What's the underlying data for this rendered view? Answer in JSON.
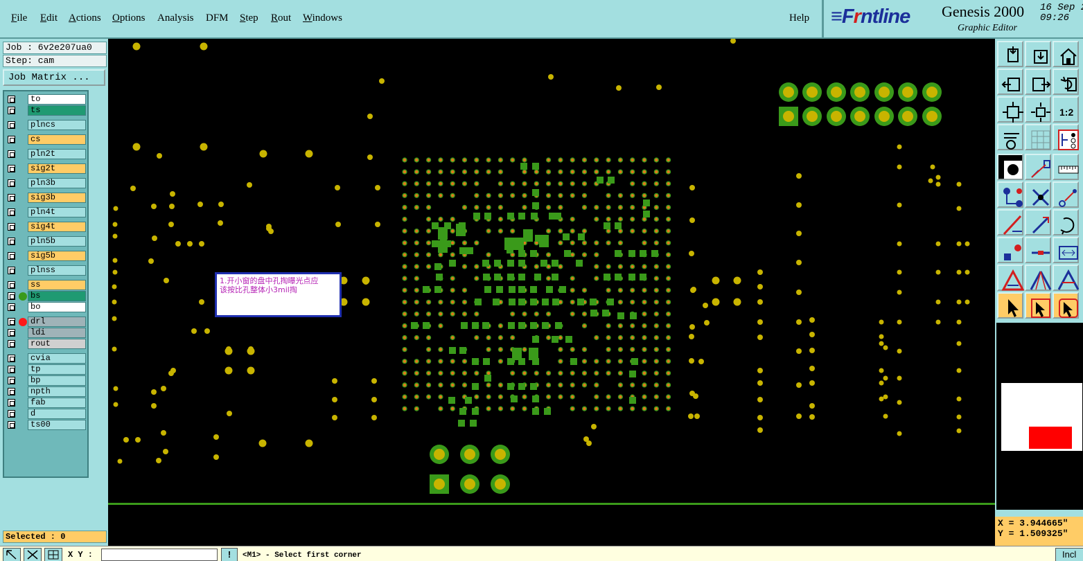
{
  "menu": [
    {
      "label": "File",
      "u": "F"
    },
    {
      "label": "Edit",
      "u": "E"
    },
    {
      "label": "Actions",
      "u": "A"
    },
    {
      "label": "Options",
      "u": "O"
    },
    {
      "label": "Analysis",
      "u": ""
    },
    {
      "label": "DFM",
      "u": ""
    },
    {
      "label": "Step",
      "u": "S"
    },
    {
      "label": "Rout",
      "u": "R"
    },
    {
      "label": "Windows",
      "u": "W"
    },
    {
      "label": "Help",
      "u": ""
    }
  ],
  "logo": {
    "brand_prefix": "F",
    "brand_r": "r",
    "brand_suffix": "ntline",
    "product": "Genesis 2000",
    "subtitle": "Graphic Editor",
    "date": "16 Sep 2",
    "time": "09:26"
  },
  "job": {
    "job_label": "Job : 6v2e207ua0",
    "step_label": "Step: cam",
    "matrix_button": "Job Matrix ..."
  },
  "layers": [
    {
      "name": "to",
      "color": "#ffffff",
      "dot": ""
    },
    {
      "name": "ts",
      "color": "#1f9a72",
      "dot": ""
    },
    {
      "name": "plncs",
      "color": "#a3dfe0",
      "dot": ""
    },
    {
      "name": "cs",
      "color": "#ffcc66",
      "dot": ""
    },
    {
      "name": "pln2t",
      "color": "#a3dfe0",
      "dot": ""
    },
    {
      "name": "sig2t",
      "color": "#ffcc66",
      "dot": ""
    },
    {
      "name": "pln3b",
      "color": "#a3dfe0",
      "dot": ""
    },
    {
      "name": "sig3b",
      "color": "#ffcc66",
      "dot": ""
    },
    {
      "name": "pln4t",
      "color": "#a3dfe0",
      "dot": ""
    },
    {
      "name": "sig4t",
      "color": "#ffcc66",
      "dot": ""
    },
    {
      "name": "pln5b",
      "color": "#a3dfe0",
      "dot": ""
    },
    {
      "name": "sig5b",
      "color": "#ffcc66",
      "dot": ""
    },
    {
      "name": "plnss",
      "color": "#a3dfe0",
      "dot": ""
    },
    {
      "name": "ss",
      "color": "#ffcc66",
      "dot": ""
    },
    {
      "name": "bs",
      "color": "#1f9a72",
      "dot": "#3a9a1a"
    },
    {
      "name": "bo",
      "color": "#ffffff",
      "dot": ""
    },
    {
      "name": "drl",
      "color": "#9fb3b8",
      "dot": "#ff1a1a"
    },
    {
      "name": "ldi",
      "color": "#9fb3b8",
      "dot": ""
    },
    {
      "name": "rout",
      "color": "#d0d0d0",
      "dot": ""
    },
    {
      "name": "cvia",
      "color": "#a3dfe0",
      "dot": ""
    },
    {
      "name": "tp",
      "color": "#a3dfe0",
      "dot": ""
    },
    {
      "name": "bp",
      "color": "#a3dfe0",
      "dot": ""
    },
    {
      "name": "npth",
      "color": "#a3dfe0",
      "dot": ""
    },
    {
      "name": "fab",
      "color": "#a3dfe0",
      "dot": ""
    },
    {
      "name": "d",
      "color": "#a3dfe0",
      "dot": ""
    },
    {
      "name": "ts00",
      "color": "#a3dfe0",
      "dot": ""
    }
  ],
  "selected": "Selected : 0",
  "note": {
    "line1": "1.开小窗的盘中孔掏曝光点应",
    "line2": "该按比孔整体小3mil掏"
  },
  "coords": {
    "x": "X = 3.944665\"",
    "y": "Y = 1.509325\""
  },
  "bottom": {
    "xy_label": "X Y :",
    "xy_value": "",
    "excl": "!",
    "prompt": "<M1> - Select first corner",
    "incl": "Incl"
  },
  "colors": {
    "bg": "#000000",
    "pad_green": "#3a9a1a",
    "pad_gold": "#c8b400",
    "via_orange": "#e07a1a",
    "panel": "#a3dfe0",
    "accent": "#ffcc66"
  }
}
